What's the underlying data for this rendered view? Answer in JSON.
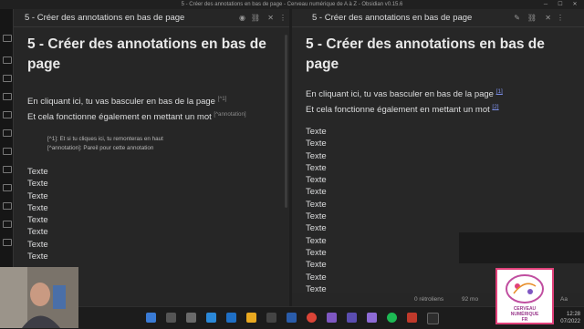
{
  "window": {
    "title": "5 - Créer des annotations en bas de page - Cerveau numérique de A à Z - Obsidian v0.15.6"
  },
  "left_pane": {
    "tab_title": "5 - Créer des annotations en bas de page",
    "heading": "5 - Créer des annotations en bas de page",
    "line1": "En cliquant ici, tu vas basculer en bas de la page",
    "line1_marker": "[^1]",
    "line2": "Et cela fonctionne également en mettant un mot",
    "line2_marker": "[^annotation]",
    "footnote1": "[^1]: Et si tu cliques ici, tu remonteras en haut",
    "footnote2": "[^annotation]: Pareil pour cette annotation",
    "texte": [
      "Texte",
      "Texte",
      "Texte",
      "Texte",
      "Texte",
      "Texte",
      "Texte",
      "Texte"
    ]
  },
  "right_pane": {
    "tab_title": "5 - Créer des annotations en bas de page",
    "heading": "5 - Créer des annotations en bas de page",
    "line1": "En cliquant ici, tu vas basculer en bas de la page",
    "line1_ref": "[1]",
    "line2": "Et cela fonctionne également en mettant un mot",
    "line2_ref": "[2]",
    "texte": [
      "Texte",
      "Texte",
      "Texte",
      "Texte",
      "Texte",
      "Texte",
      "Texte",
      "Texte",
      "Texte",
      "Texte",
      "Texte",
      "Texte",
      "Texte",
      "Texte"
    ]
  },
  "status_bar": {
    "backlinks": "0 rétroliens",
    "words": "92 mo",
    "extra": "Aa"
  },
  "taskbar": {
    "time": "12:28",
    "date": "07/2022"
  },
  "logo": {
    "line1": "CERVEAU",
    "line2": "NUMÉRIQUE",
    "line3": "FR"
  }
}
